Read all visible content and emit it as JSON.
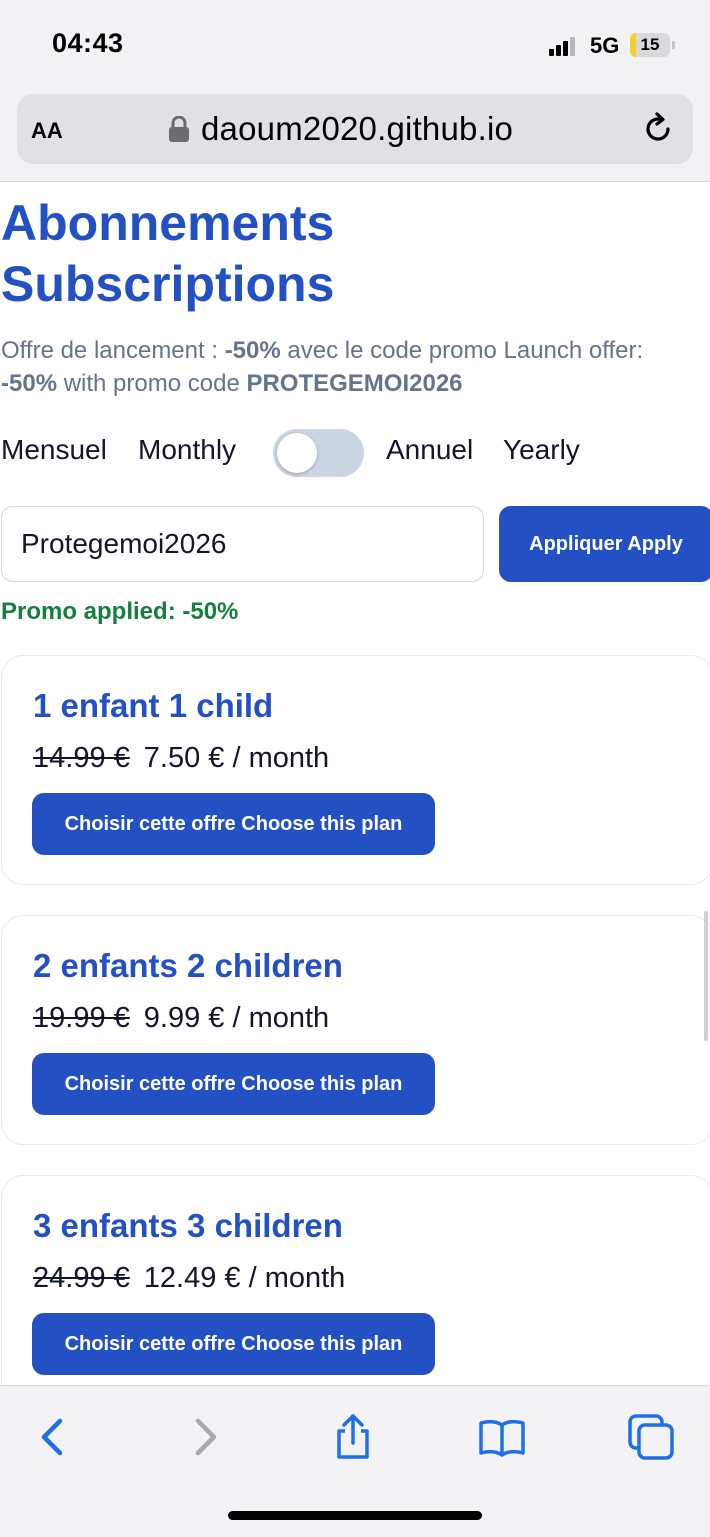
{
  "status_bar": {
    "time": "04:43",
    "network": "5G",
    "battery_level": "15",
    "battery_fill_percent": 15,
    "battery_color": "#f7cf2d"
  },
  "browser": {
    "text_size_label": "AA",
    "url": "daoum2020.github.io",
    "lock_icon": "lock-icon",
    "reload_icon": "reload-icon"
  },
  "page": {
    "title_line1": "Abonnements",
    "title_line2": "Subscriptions",
    "promo_intro": {
      "text_a": "Offre de lancement : ",
      "discount_a": "-50%",
      "text_b": " avec le code promo Launch offer: ",
      "discount_b": "-50%",
      "text_c": " with promo code ",
      "code": "PROTEGEMOI2026"
    },
    "billing": {
      "monthly_fr": "Mensuel",
      "monthly_en": "Monthly",
      "yearly_fr": "Annuel",
      "yearly_en": "Yearly",
      "toggle_on": false
    },
    "promo_input_value": "Protegemoi2026",
    "apply_label": "Appliquer Apply",
    "promo_status": "Promo applied: -50%",
    "plans": [
      {
        "name": "1 enfant 1 child",
        "old_price": "14.99 €",
        "new_price": "7.50 € / month",
        "button": "Choisir cette offre Choose this plan"
      },
      {
        "name": "2 enfants 2 children",
        "old_price": "19.99 €",
        "new_price": "9.99 € / month",
        "button": "Choisir cette offre Choose this plan"
      },
      {
        "name": "3 enfants 3 children",
        "old_price": "24.99 €",
        "new_price": "12.49 € / month",
        "button": "Choisir cette offre Choose this plan"
      }
    ]
  },
  "colors": {
    "accent": "#2350c2",
    "success": "#15803d",
    "muted_text": "#64748b",
    "toolbar_icon": "#1f6feb"
  },
  "toolbar": {
    "icons": [
      "back-icon",
      "forward-icon",
      "share-icon",
      "bookmarks-icon",
      "tabs-icon"
    ]
  }
}
